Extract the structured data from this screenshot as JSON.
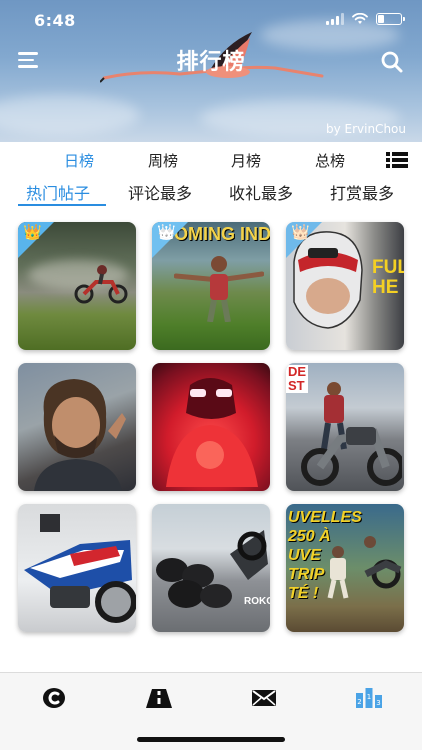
{
  "status_bar": {
    "time": "6:48"
  },
  "header": {
    "title": "排行榜",
    "byline": "by ErvinChou"
  },
  "period_tabs": [
    {
      "label": "日榜",
      "active": true
    },
    {
      "label": "周榜",
      "active": false
    },
    {
      "label": "月榜",
      "active": false
    },
    {
      "label": "总榜",
      "active": false
    }
  ],
  "category_tabs": [
    {
      "label": "热门帖子",
      "active": true
    },
    {
      "label": "评论最多",
      "active": false
    },
    {
      "label": "收礼最多",
      "active": false
    },
    {
      "label": "打赏最多",
      "active": false
    }
  ],
  "posts": [
    {
      "rank_badge": "gold-crown",
      "overlay": ""
    },
    {
      "rank_badge": "silver-crown",
      "overlay": "OMING INDI"
    },
    {
      "rank_badge": "bronze-crown",
      "overlay": "FUL\nHE"
    },
    {
      "rank_badge": "",
      "overlay": ""
    },
    {
      "rank_badge": "",
      "overlay": ""
    },
    {
      "rank_badge": "",
      "overlay": "DE\nST"
    },
    {
      "rank_badge": "",
      "overlay": ""
    },
    {
      "rank_badge": "",
      "overlay": "ROKO"
    },
    {
      "rank_badge": "",
      "overlay": "UVELLES\n250 À\nUVE\nTRIP\nTÉ !"
    }
  ],
  "colors": {
    "accent": "#2a8de0",
    "crown_corner": "#59b4ec"
  },
  "tabbar": {
    "icons": [
      "tab-home-icon",
      "tab-road-icon",
      "tab-mail-icon",
      "tab-ranking-icon"
    ],
    "active_index": 3
  }
}
